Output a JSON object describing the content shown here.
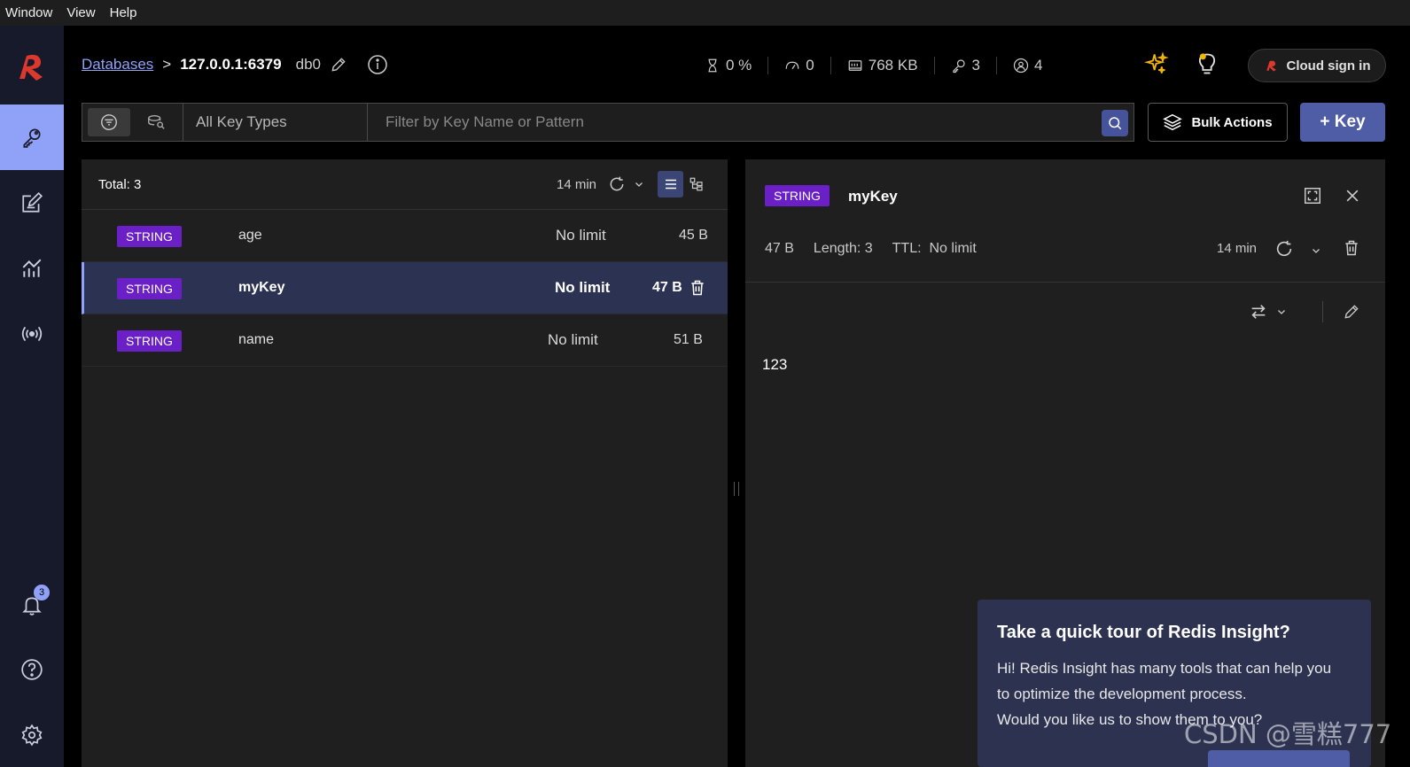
{
  "menubar": {
    "items": [
      "Window",
      "View",
      "Help"
    ]
  },
  "sidebar": {
    "items": [
      {
        "name": "browser",
        "icon": "key-icon",
        "active": true
      },
      {
        "name": "workbench",
        "icon": "edit-icon",
        "active": false
      },
      {
        "name": "analysis",
        "icon": "analytics-icon",
        "active": false
      },
      {
        "name": "pubsub",
        "icon": "broadcast-icon",
        "active": false
      }
    ],
    "notifications_count": "3"
  },
  "header": {
    "breadcrumb_link": "Databases",
    "breadcrumb_sep": ">",
    "host": "127.0.0.1:6379",
    "db": "db0",
    "stats": {
      "cpu": "0 %",
      "ops": "0",
      "memory": "768 KB",
      "keys": "3",
      "clients": "4"
    },
    "cloud_label": "Cloud sign in"
  },
  "filter": {
    "key_type": "All Key Types",
    "search_placeholder": "Filter by Key Name or Pattern"
  },
  "actions": {
    "bulk": "Bulk Actions",
    "add_key": "+ Key"
  },
  "keylist": {
    "total": "Total: 3",
    "refreshed": "14 min",
    "rows": [
      {
        "type": "STRING",
        "name": "age",
        "ttl": "No limit",
        "size": "45 B"
      },
      {
        "type": "STRING",
        "name": "myKey",
        "ttl": "No limit",
        "size": "47 B"
      },
      {
        "type": "STRING",
        "name": "name",
        "ttl": "No limit",
        "size": "51 B"
      }
    ]
  },
  "detail": {
    "type": "STRING",
    "name": "myKey",
    "size": "47 B",
    "length": "Length: 3",
    "ttl_label": "TTL:",
    "ttl_value": "No limit",
    "refreshed": "14 min",
    "value": "123"
  },
  "tour": {
    "title": "Take a quick tour of Redis Insight?",
    "line1": "Hi! Redis Insight has many tools that can help you",
    "line2": "to optimize the development process.",
    "line3": "Would you like us to show them to you?"
  },
  "watermark": "CSDN @雪糕777",
  "colors": {
    "accent": "#8fa2f7",
    "string_tag": "#6b1fc7",
    "primary_button": "#4f5da6",
    "brand": "#dc382d"
  }
}
